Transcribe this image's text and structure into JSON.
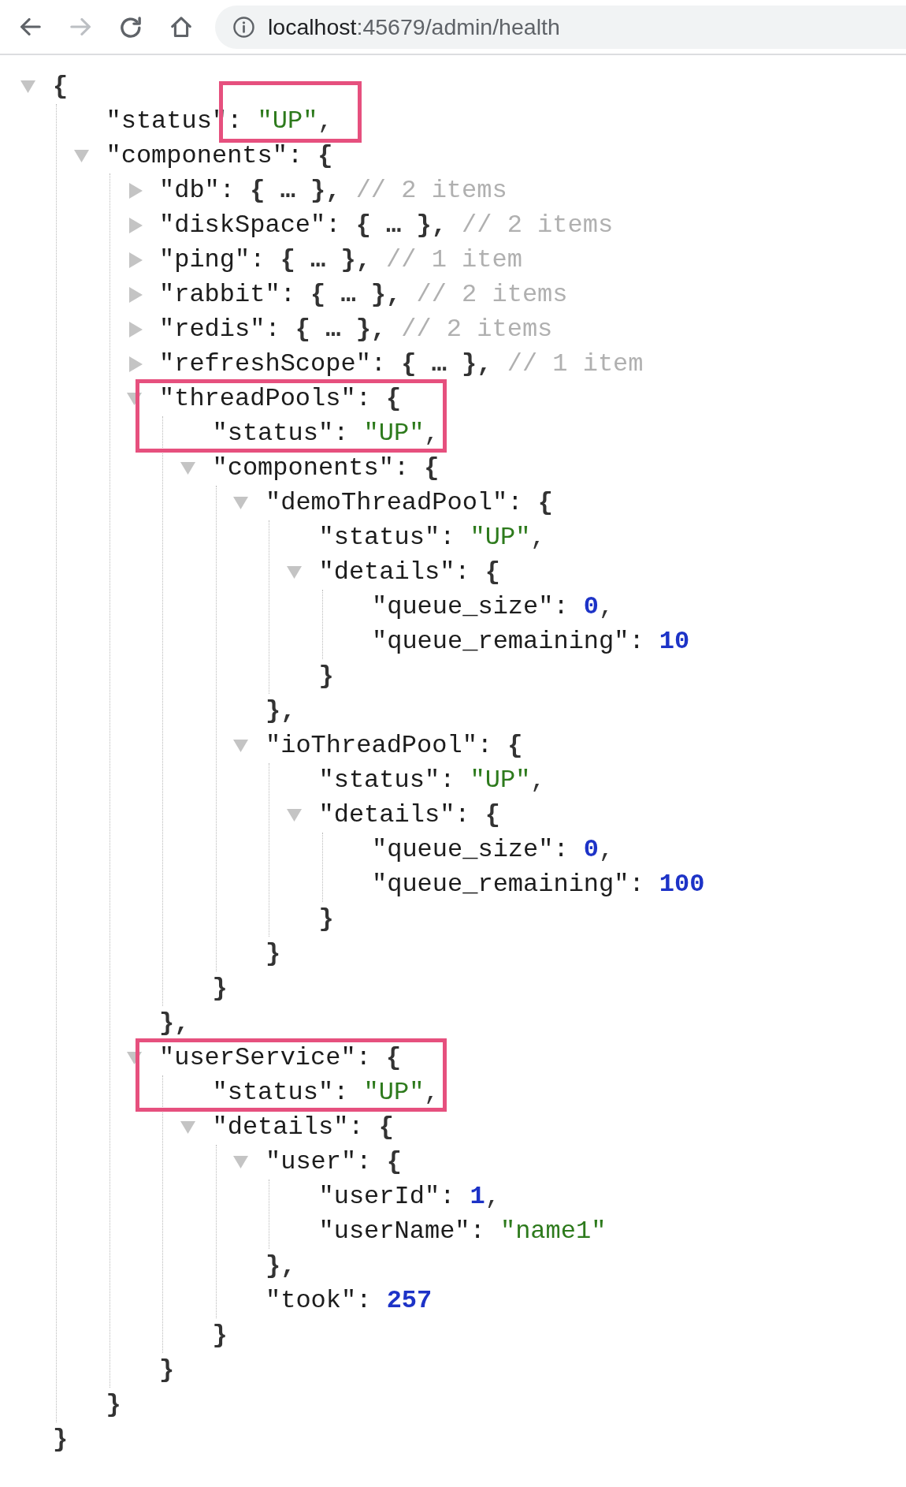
{
  "toolbar": {
    "buttons": [
      {
        "kind": "back",
        "disabled": false
      },
      {
        "kind": "forward",
        "disabled": true
      },
      {
        "kind": "reload",
        "disabled": false
      },
      {
        "kind": "home",
        "disabled": false
      }
    ],
    "address_bar": {
      "host": "localhost",
      "path": ":45679/admin/health"
    }
  },
  "json_view": {
    "root": {
      "kind": "object",
      "expanded": true,
      "open": "{",
      "close": "}",
      "children": [
        {
          "kind": "string",
          "key": "\"status\":",
          "value": "\"UP\"",
          "tail": ",",
          "highlighted": true
        },
        {
          "kind": "object",
          "key": "\"components\":",
          "expanded": true,
          "open": "{",
          "close": "}",
          "children": [
            {
              "kind": "object",
              "key": "\"db\":",
              "expanded": false,
              "collapsed_text": "{ … },",
              "comment": "// 2 items"
            },
            {
              "kind": "object",
              "key": "\"diskSpace\":",
              "expanded": false,
              "collapsed_text": "{ … },",
              "comment": "// 2 items"
            },
            {
              "kind": "object",
              "key": "\"ping\":",
              "expanded": false,
              "collapsed_text": "{ … },",
              "comment": "// 1 item"
            },
            {
              "kind": "object",
              "key": "\"rabbit\":",
              "expanded": false,
              "collapsed_text": "{ … },",
              "comment": "// 2 items"
            },
            {
              "kind": "object",
              "key": "\"redis\":",
              "expanded": false,
              "collapsed_text": "{ … },",
              "comment": "// 2 items"
            },
            {
              "kind": "object",
              "key": "\"refreshScope\":",
              "expanded": false,
              "collapsed_text": "{ … },",
              "comment": "// 1 item"
            },
            {
              "kind": "object",
              "key": "\"threadPools\":",
              "expanded": true,
              "highlighted": true,
              "open": "{",
              "close": "},",
              "children": [
                {
                  "kind": "string",
                  "key": "\"status\":",
                  "value": "\"UP\"",
                  "tail": ","
                },
                {
                  "kind": "object",
                  "key": "\"components\":",
                  "expanded": true,
                  "open": "{",
                  "close": "}",
                  "children": [
                    {
                      "kind": "object",
                      "key": "\"demoThreadPool\":",
                      "expanded": true,
                      "open": "{",
                      "close": "},",
                      "children": [
                        {
                          "kind": "string",
                          "key": "\"status\":",
                          "value": "\"UP\"",
                          "tail": ","
                        },
                        {
                          "kind": "object",
                          "key": "\"details\":",
                          "expanded": true,
                          "open": "{",
                          "close": "}",
                          "children": [
                            {
                              "kind": "number",
                              "key": "\"queue_size\":",
                              "value": "0",
                              "tail": ","
                            },
                            {
                              "kind": "number",
                              "key": "\"queue_remaining\":",
                              "value": "10"
                            }
                          ]
                        }
                      ]
                    },
                    {
                      "kind": "object",
                      "key": "\"ioThreadPool\":",
                      "expanded": true,
                      "open": "{",
                      "close": "}",
                      "children": [
                        {
                          "kind": "string",
                          "key": "\"status\":",
                          "value": "\"UP\"",
                          "tail": ","
                        },
                        {
                          "kind": "object",
                          "key": "\"details\":",
                          "expanded": true,
                          "open": "{",
                          "close": "}",
                          "children": [
                            {
                              "kind": "number",
                              "key": "\"queue_size\":",
                              "value": "0",
                              "tail": ","
                            },
                            {
                              "kind": "number",
                              "key": "\"queue_remaining\":",
                              "value": "100"
                            }
                          ]
                        }
                      ]
                    }
                  ]
                }
              ]
            },
            {
              "kind": "object",
              "key": "\"userService\":",
              "expanded": true,
              "highlighted": true,
              "open": "{",
              "close": "}",
              "children": [
                {
                  "kind": "string",
                  "key": "\"status\":",
                  "value": "\"UP\"",
                  "tail": ","
                },
                {
                  "kind": "object",
                  "key": "\"details\":",
                  "expanded": true,
                  "open": "{",
                  "close": "}",
                  "children": [
                    {
                      "kind": "object",
                      "key": "\"user\":",
                      "expanded": true,
                      "open": "{",
                      "close": "},",
                      "children": [
                        {
                          "kind": "number",
                          "key": "\"userId\":",
                          "value": "1",
                          "tail": ","
                        },
                        {
                          "kind": "string",
                          "key": "\"userName\":",
                          "value": "\"name1\""
                        }
                      ]
                    },
                    {
                      "kind": "number",
                      "key": "\"took\":",
                      "value": "257"
                    }
                  ]
                }
              ]
            }
          ]
        }
      ]
    }
  }
}
